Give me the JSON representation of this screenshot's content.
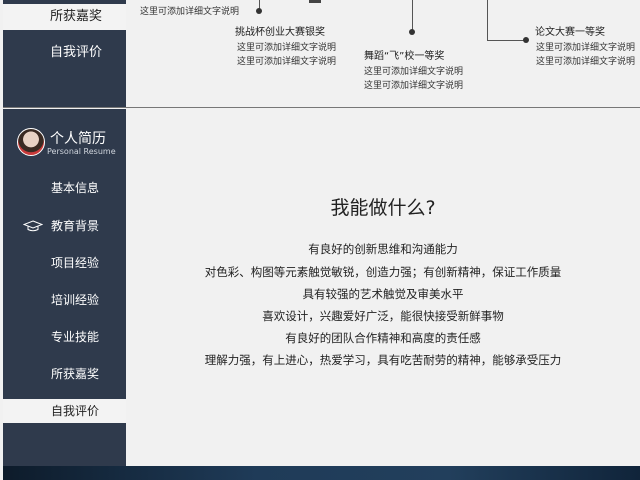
{
  "top_slide": {
    "active_nav": "所获嘉奖",
    "nav_next": "自我评价",
    "items": [
      {
        "title": "",
        "desc": [
          "这里可添加详细文字说明"
        ]
      },
      {
        "title": "挑战杯创业大赛银奖",
        "desc": [
          "这里可添加详细文字说明",
          "这里可添加详细文字说明"
        ]
      },
      {
        "title": "舞蹈“飞”校一等奖",
        "desc": [
          "这里可添加详细文字说明",
          "这里可添加详细文字说明"
        ]
      },
      {
        "title": "论文大赛一等奖",
        "desc": [
          "这里可添加详细文字说明",
          "这里可添加详细文字说明"
        ]
      }
    ]
  },
  "profile": {
    "title": "个人简历",
    "subtitle": "Personal Resume"
  },
  "sidebar": {
    "items": [
      {
        "label": "基本信息"
      },
      {
        "label": "教育背景",
        "icon": "graduation-cap-icon"
      },
      {
        "label": "项目经验"
      },
      {
        "label": "培训经验"
      },
      {
        "label": "专业技能"
      },
      {
        "label": "所获嘉奖"
      },
      {
        "label": "自我评价",
        "active": true
      }
    ]
  },
  "main": {
    "heading": "我能做什么?",
    "lines": [
      "有良好的创新思维和沟通能力",
      "对色彩、构图等元素触觉敏锐，创造力强；有创新精神，保证工作质量",
      "具有较强的艺术触觉及审美水平",
      "喜欢设计，兴趣爱好广泛，能很快接受新鲜事物",
      "有良好的团队合作精神和高度的责任感",
      "理解力强，有上进心，热爱学习，具有吃苦耐劳的精神，能够承受压力"
    ]
  },
  "colors": {
    "sidebar": "#2f3a4c",
    "background": "#f1f1f1",
    "active_item": "#f3f3f3"
  }
}
